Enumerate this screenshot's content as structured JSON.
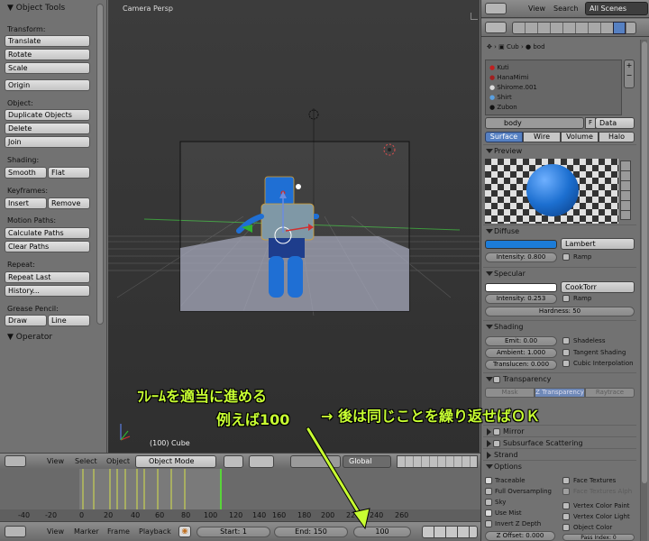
{
  "tool_panel": {
    "title": "Object Tools",
    "sections": {
      "transform": {
        "label": "Transform:",
        "translate": "Translate",
        "rotate": "Rotate",
        "scale": "Scale"
      },
      "origin": "Origin",
      "object": {
        "label": "Object:",
        "duplicate": "Duplicate Objects",
        "delete": "Delete",
        "join": "Join"
      },
      "shading": {
        "label": "Shading:",
        "smooth": "Smooth",
        "flat": "Flat"
      },
      "keyframes": {
        "label": "Keyframes:",
        "insert": "Insert",
        "remove": "Remove"
      },
      "motion_paths": {
        "label": "Motion Paths:",
        "calculate": "Calculate Paths",
        "clear": "Clear Paths"
      },
      "repeat": {
        "label": "Repeat:",
        "repeat_last": "Repeat Last",
        "history": "History..."
      },
      "grease_pencil": {
        "label": "Grease Pencil:",
        "draw": "Draw",
        "line": "Line"
      },
      "operator": "Operator"
    }
  },
  "viewport": {
    "camera_label": "Camera Persp",
    "object_label": "(100) Cube",
    "header": {
      "view": "View",
      "select": "Select",
      "object": "Object",
      "mode": "Object Mode",
      "orientation": "Global"
    }
  },
  "properties": {
    "header": {
      "view": "View",
      "search": "Search",
      "scenes": "All Scenes"
    },
    "breadcrumb": {
      "obj": "Cub",
      "mat": "bod"
    },
    "materials": [
      "Kuti",
      "HanaMimi",
      "Shirome.001",
      "Shirt",
      "Zubon"
    ],
    "material_name": "body",
    "material_users": "F",
    "data_dropdown": "Data",
    "tabs": [
      "Surface",
      "Wire",
      "Volume",
      "Halo"
    ],
    "preview_title": "Preview",
    "diffuse": {
      "title": "Diffuse",
      "shader": "Lambert",
      "intensity": "Intensity: 0.800",
      "ramp": "Ramp",
      "color": "#1c7cd8"
    },
    "specular": {
      "title": "Specular",
      "shader": "CookTorr",
      "intensity": "Intensity: 0.253",
      "ramp": "Ramp",
      "hardness": "Hardness: 50"
    },
    "shading": {
      "title": "Shading",
      "emit": "Emit: 0.00",
      "ambient": "Ambient: 1.000",
      "translucency": "Translucen: 0.000",
      "shadeless": "Shadeless",
      "tangent": "Tangent Shading",
      "cubic": "Cubic Interpolation"
    },
    "transparency": {
      "title": "Transparency",
      "mask": "Mask",
      "ztrans": "Z Transparency",
      "raytrace": "Raytrace"
    },
    "mirror": "Mirror",
    "sss": "Subsurface Scattering",
    "strand": "Strand",
    "options": {
      "title": "Options",
      "traceable": "Traceable",
      "full_os": "Full Oversampling",
      "sky": "Sky",
      "use_mist": "Use Mist",
      "invert_z": "Invert Z Depth",
      "z_offset": "Z Offset: 0.000",
      "face_textures": "Face Textures",
      "face_textures_alpha": "Face Textures Alph",
      "vcol_paint": "Vertex Color Paint",
      "vcol_light": "Vertex Color Light",
      "object_color": "Object Color",
      "pass_index": "Pass Index: 0"
    }
  },
  "timeline": {
    "ticks": [
      "-40",
      "-20",
      "0",
      "20",
      "40",
      "60",
      "80",
      "100",
      "120",
      "140",
      "160",
      "180",
      "200",
      "220",
      "240",
      "260"
    ],
    "menus": {
      "view": "View",
      "marker": "Marker",
      "frame": "Frame",
      "playback": "Playback"
    },
    "start": "Start: 1",
    "end": "End: 150",
    "current": "100"
  },
  "annotations": {
    "line1": "ﾌﾚｰﾑを適当に進める",
    "line2": "例えば100",
    "line3": "→ 後は同じことを繰り返せばＯＫ"
  }
}
